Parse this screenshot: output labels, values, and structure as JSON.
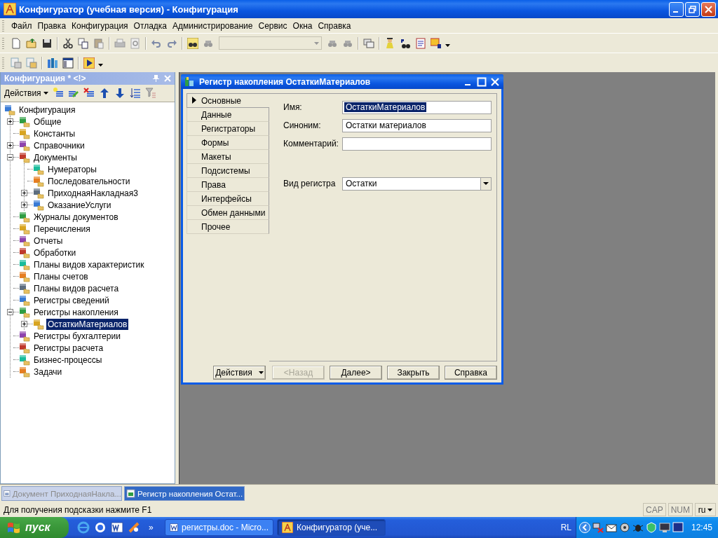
{
  "window": {
    "title": "Конфигуратор (учебная версия) - Конфигурация"
  },
  "menu": [
    {
      "label": "Файл"
    },
    {
      "label": "Правка"
    },
    {
      "label": "Конфигурация"
    },
    {
      "label": "Отладка"
    },
    {
      "label": "Администрирование"
    },
    {
      "label": "Сервис"
    },
    {
      "label": "Окна"
    },
    {
      "label": "Справка"
    }
  ],
  "config_panel": {
    "title": "Конфигурация * <!>",
    "actions_label": "Действия",
    "tree": {
      "label": "Конфигурация",
      "selected": false,
      "children": [
        {
          "label": "Общие",
          "has_children": true,
          "expanded": false,
          "selected": false
        },
        {
          "label": "Константы",
          "has_children": false,
          "selected": false
        },
        {
          "label": "Справочники",
          "has_children": true,
          "expanded": false,
          "selected": false
        },
        {
          "label": "Документы",
          "has_children": true,
          "expanded": true,
          "selected": false,
          "children": [
            {
              "label": "Нумераторы",
              "has_children": false,
              "selected": false
            },
            {
              "label": "Последовательности",
              "has_children": false,
              "selected": false
            },
            {
              "label": "ПриходнаяНакладная3",
              "has_children": true,
              "expanded": false,
              "selected": false
            },
            {
              "label": "ОказаниеУслуги",
              "has_children": true,
              "expanded": false,
              "selected": false
            }
          ]
        },
        {
          "label": "Журналы документов",
          "has_children": false,
          "selected": false
        },
        {
          "label": "Перечисления",
          "has_children": false,
          "selected": false
        },
        {
          "label": "Отчеты",
          "has_children": false,
          "selected": false
        },
        {
          "label": "Обработки",
          "has_children": false,
          "selected": false
        },
        {
          "label": "Планы видов характеристик",
          "has_children": false,
          "selected": false
        },
        {
          "label": "Планы счетов",
          "has_children": false,
          "selected": false
        },
        {
          "label": "Планы видов расчета",
          "has_children": false,
          "selected": false
        },
        {
          "label": "Регистры сведений",
          "has_children": false,
          "selected": false
        },
        {
          "label": "Регистры накопления",
          "has_children": true,
          "expanded": true,
          "selected": false,
          "children": [
            {
              "label": "ОстаткиМатериалов",
              "has_children": true,
              "expanded": false,
              "selected": true
            }
          ]
        },
        {
          "label": "Регистры бухгалтерии",
          "has_children": false,
          "selected": false
        },
        {
          "label": "Регистры расчета",
          "has_children": false,
          "selected": false
        },
        {
          "label": "Бизнес-процессы",
          "has_children": false,
          "selected": false
        },
        {
          "label": "Задачи",
          "has_children": false,
          "selected": false
        }
      ]
    }
  },
  "dialog": {
    "title": "Регистр накопления ОстаткиМатериалов",
    "tabs": [
      {
        "label": "Основные",
        "selected": true
      },
      {
        "label": "Данные",
        "selected": false
      },
      {
        "label": "Регистраторы",
        "selected": false
      },
      {
        "label": "Формы",
        "selected": false
      },
      {
        "label": "Макеты",
        "selected": false
      },
      {
        "label": "Подсистемы",
        "selected": false
      },
      {
        "label": "Права",
        "selected": false
      },
      {
        "label": "Интерфейсы",
        "selected": false
      },
      {
        "label": "Обмен данными",
        "selected": false
      },
      {
        "label": "Прочее",
        "selected": false
      }
    ],
    "fields": [
      {
        "label": "Имя:",
        "kind": "text",
        "value": "ОстаткиМатериалов",
        "highlighted": true
      },
      {
        "label": "Синоним:",
        "kind": "text",
        "value": "Остатки материалов",
        "highlighted": false
      },
      {
        "label": "Комментарий:",
        "kind": "text"
      },
      {
        "label": "Вид регистра",
        "kind": "select",
        "value": "Остатки"
      }
    ],
    "buttons": [
      {
        "label": "Действия",
        "kind": "menu",
        "disabled": false
      },
      {
        "label": "<Назад",
        "kind": "plain",
        "disabled": true
      },
      {
        "label": "Далее>",
        "kind": "plain",
        "disabled": false
      },
      {
        "label": "Закрыть",
        "kind": "plain",
        "disabled": false
      },
      {
        "label": "Справка",
        "kind": "plain",
        "disabled": false
      }
    ]
  },
  "window_tabs": [
    {
      "label": "Документ ПриходнаяНакла...",
      "selected": false
    },
    {
      "label": "Регистр накопления Остат...",
      "selected": true
    }
  ],
  "status_bar": {
    "hint": "Для получения подсказки нажмите F1",
    "indicators": [
      {
        "label": "CAP",
        "kind": "plain"
      },
      {
        "label": "NUM",
        "kind": "plain"
      },
      {
        "label": "ru",
        "kind": "menu"
      }
    ]
  },
  "taskbar": {
    "start": "пуск",
    "more": "»",
    "tasks": [
      {
        "label": "регистры.doc - Micro...",
        "kind": "word",
        "selected": false
      },
      {
        "label": "Конфигуратор (уче...",
        "kind": "config",
        "selected": true
      }
    ],
    "lang": "RL",
    "clock": "12:45"
  }
}
